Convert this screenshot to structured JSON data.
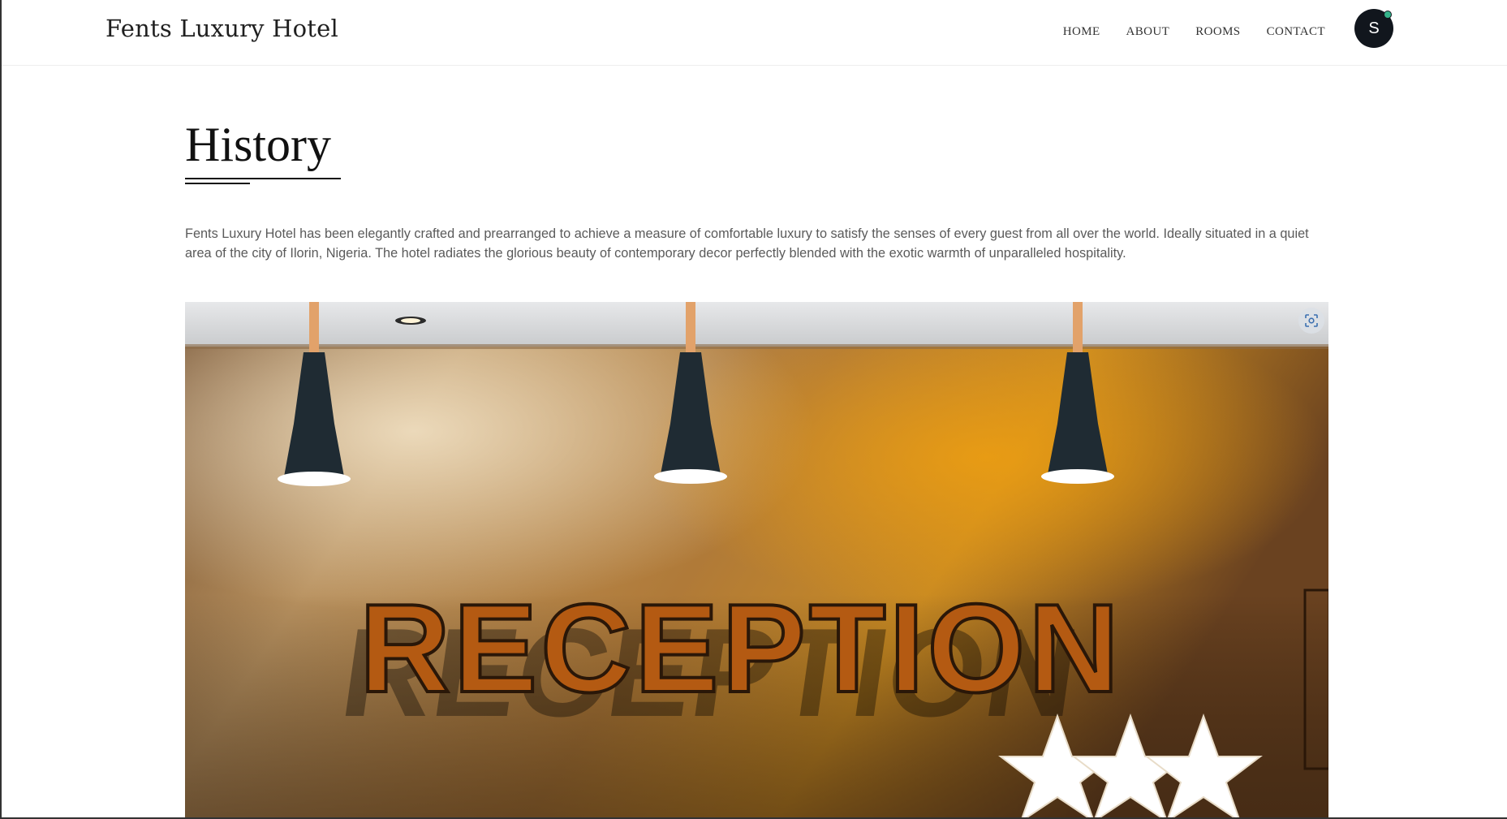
{
  "header": {
    "brand": "Fents Luxury Hotel",
    "nav": [
      {
        "label": "HOME"
      },
      {
        "label": "ABOUT"
      },
      {
        "label": "ROOMS"
      },
      {
        "label": "CONTACT"
      }
    ],
    "avatar_initial": "S",
    "avatar_status_color": "#34b38a"
  },
  "section": {
    "title": "History",
    "body": "Fents Luxury Hotel has been elegantly crafted and prearranged to achieve a measure of comfortable luxury to satisfy the senses of every guest from all over the world. Ideally situated in a quiet area of the city of Ilorin, Nigeria. The hotel radiates the glorious beauty of contemporary decor perfectly blended with the exotic warmth of unparalleled hospitality."
  },
  "hero": {
    "sign_text": "RECEPTION",
    "lens_icon": "visual-search-icon"
  }
}
